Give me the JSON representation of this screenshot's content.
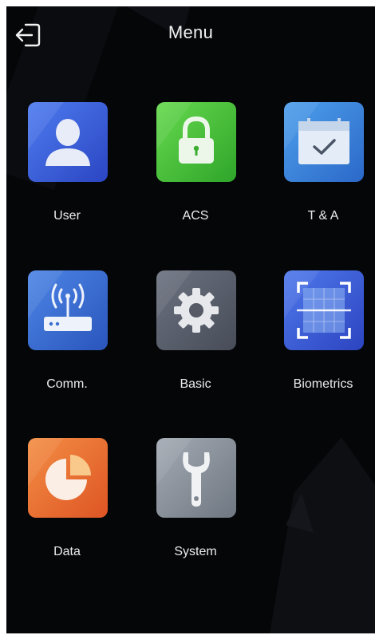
{
  "header": {
    "title": "Menu",
    "back_icon": "exit-arrow-icon"
  },
  "menu": {
    "items": [
      {
        "label": "User",
        "icon": "user-icon",
        "color": "#3f63d8"
      },
      {
        "label": "ACS",
        "icon": "padlock-icon",
        "color": "#45c03a"
      },
      {
        "label": "T & A",
        "icon": "calendar-check-icon",
        "color": "#3a8ad8"
      },
      {
        "label": "Comm.",
        "icon": "router-icon",
        "color": "#3a6fd0"
      },
      {
        "label": "Basic",
        "icon": "gear-icon",
        "color": "#5c6270"
      },
      {
        "label": "Biometrics",
        "icon": "scan-frame-icon",
        "color": "#3f5fd8"
      },
      {
        "label": "Data",
        "icon": "pie-chart-icon",
        "color": "#ea6a2c"
      },
      {
        "label": "System",
        "icon": "wrench-icon",
        "color": "#8e959f"
      }
    ]
  }
}
